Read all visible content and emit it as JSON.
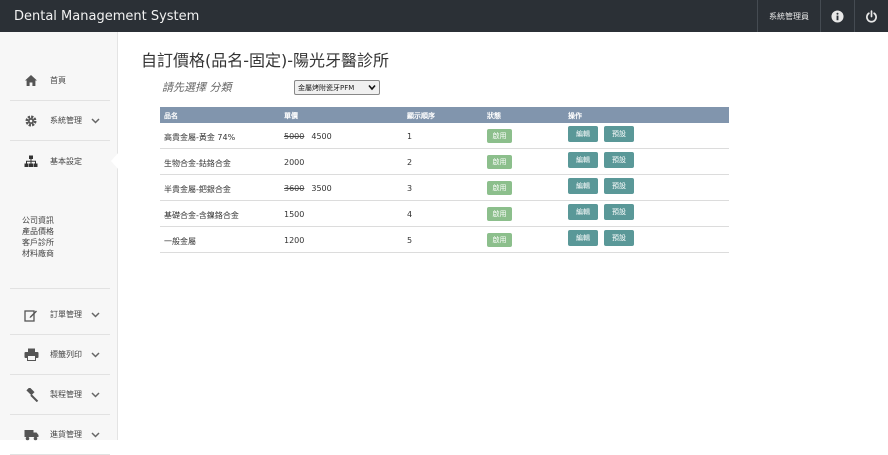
{
  "app": {
    "title": "Dental Management System"
  },
  "topbar": {
    "user_label": "系統管理員",
    "icons": [
      "info-icon",
      "power-icon"
    ]
  },
  "sidebar": {
    "items": [
      {
        "label": "首頁",
        "icon": "home-icon"
      },
      {
        "label": "系統管理",
        "icon": "gear-icon"
      },
      {
        "label": "基本設定",
        "icon": "sitemap-icon"
      },
      {
        "label": "訂單管理",
        "icon": "edit-icon"
      },
      {
        "label": "標籤列印",
        "icon": "printer-icon"
      },
      {
        "label": "製程管理",
        "icon": "gavel-icon"
      },
      {
        "label": "進貨管理",
        "icon": "truck-icon"
      }
    ],
    "sub_items": [
      "公司資訊",
      "產品價格",
      "客戶診所",
      "材料廠商"
    ]
  },
  "page": {
    "title": "自訂價格(品名-固定)-陽光牙醫診所"
  },
  "filter": {
    "label": "請先選擇 分類",
    "selected": "金屬烤附瓷牙PFM"
  },
  "table": {
    "headers": [
      "品名",
      "單價",
      "顯示順序",
      "狀態",
      "操作"
    ],
    "rows": [
      {
        "name": "高貴金屬-黃金 74%",
        "old_price": "5000",
        "price": "4500",
        "order": "1",
        "status": "啟用",
        "edit": "編輯",
        "preset": "預設"
      },
      {
        "name": "生物合金-鈷鉻合金",
        "old_price": "",
        "price": "2000",
        "order": "2",
        "status": "啟用",
        "edit": "編輯",
        "preset": "預設"
      },
      {
        "name": "半貴金屬-鈀銀合金",
        "old_price": "3600",
        "price": "3500",
        "order": "3",
        "status": "啟用",
        "edit": "編輯",
        "preset": "預設"
      },
      {
        "name": "基礎合金-含鎳鉻合金",
        "old_price": "",
        "price": "1500",
        "order": "4",
        "status": "啟用",
        "edit": "編輯",
        "preset": "預設"
      },
      {
        "name": "一般金屬",
        "old_price": "",
        "price": "1200",
        "order": "5",
        "status": "啟用",
        "edit": "編輯",
        "preset": "預設"
      }
    ]
  },
  "colors": {
    "topbar": "#2b3036",
    "table_header": "#8195ad",
    "status_green": "#8cbf8c",
    "action_teal": "#5a9898"
  }
}
